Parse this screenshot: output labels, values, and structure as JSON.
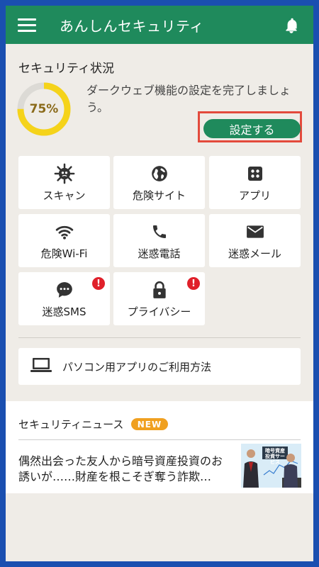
{
  "header": {
    "title": "あんしんセキュリティ",
    "menu_icon": "hamburger-menu-icon",
    "bell_icon": "bell-icon"
  },
  "status": {
    "title": "セキュリティ状況",
    "progress_text": "75%",
    "progress_value": 0.75,
    "message": "ダークウェブ機能の設定を完了しましょう。",
    "button_label": "設定する",
    "highlight_color": "#e34a3c"
  },
  "features": [
    {
      "label": "スキャン",
      "icon": "virus-icon",
      "alert": false
    },
    {
      "label": "危険サイト",
      "icon": "globe-icon",
      "alert": false
    },
    {
      "label": "アプリ",
      "icon": "apps-icon",
      "alert": false
    },
    {
      "label": "危険Wi-Fi",
      "icon": "wifi-icon",
      "alert": false
    },
    {
      "label": "迷惑電話",
      "icon": "phone-icon",
      "alert": false
    },
    {
      "label": "迷惑メール",
      "icon": "mail-icon",
      "alert": false
    },
    {
      "label": "迷惑SMS",
      "icon": "chat-icon",
      "alert": true,
      "alert_mark": "!"
    },
    {
      "label": "プライバシー",
      "icon": "lock-icon",
      "alert": true,
      "alert_mark": "!"
    }
  ],
  "pc_app": {
    "label": "パソコン用アプリのご利用方法",
    "icon": "laptop-icon"
  },
  "news": {
    "title": "セキュリティニュース",
    "badge": "NEW",
    "headline": "偶然出会った友人から暗号資産投資のお誘いが……財産を根こそぎ奪う詐欺…",
    "thumb_text": "暗号資産 投資サービス"
  },
  "colors": {
    "primary": "#1f8a5c",
    "background": "#efece7",
    "frame": "#1a4fb0",
    "alert": "#e0202a",
    "badge": "#f0a020",
    "ring": "#f5d31a"
  }
}
